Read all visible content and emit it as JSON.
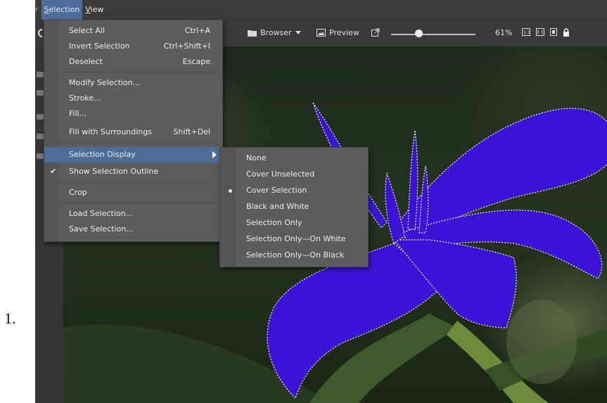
{
  "step_number": "1.",
  "menubar": {
    "items": [
      {
        "label": "r"
      },
      {
        "label": "Selection"
      },
      {
        "label": "View"
      }
    ]
  },
  "toolbar": {
    "browser_label": "Browser",
    "preview_label": "Preview",
    "zoom_value": "61%"
  },
  "selection_menu": {
    "items": [
      {
        "label": "Select All",
        "shortcut": "Ctrl+A"
      },
      {
        "label": "Invert Selection",
        "shortcut": "Ctrl+Shift+I"
      },
      {
        "label": "Deselect",
        "shortcut": "Escape"
      },
      {
        "label": "Modify Selection...",
        "shortcut": ""
      },
      {
        "label": "Stroke...",
        "shortcut": ""
      },
      {
        "label": "Fill...",
        "shortcut": ""
      },
      {
        "label": "Fill with Surroundings",
        "shortcut": "Shift+Del"
      },
      {
        "label": "Selection Display",
        "shortcut": ""
      },
      {
        "label": "Show Selection Outline",
        "shortcut": ""
      },
      {
        "label": "Crop",
        "shortcut": ""
      },
      {
        "label": "Load Selection...",
        "shortcut": ""
      },
      {
        "label": "Save Selection...",
        "shortcut": ""
      }
    ]
  },
  "selection_display_submenu": {
    "items": [
      {
        "label": "None"
      },
      {
        "label": "Cover Unselected"
      },
      {
        "label": "Cover Selection",
        "selected": true
      },
      {
        "label": "Black and White"
      },
      {
        "label": "Selection Only"
      },
      {
        "label": "Selection Only—On White"
      },
      {
        "label": "Selection Only—On Black"
      }
    ]
  },
  "colors": {
    "highlight": "#4a6d99",
    "selection_cover": "#3b13d6",
    "menu_bg": "#5c5c5c"
  }
}
